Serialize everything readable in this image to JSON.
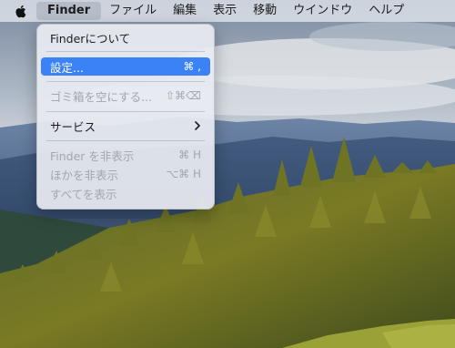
{
  "menubar": {
    "apple_icon": "apple-icon",
    "items": [
      "Finder",
      "ファイル",
      "編集",
      "表示",
      "移動",
      "ウインドウ",
      "ヘルプ"
    ]
  },
  "finder_menu": {
    "items": [
      {
        "label": "Finderについて",
        "shortcut": ""
      },
      {
        "label": "設定...",
        "shortcut": "⌘ ,",
        "state": "selected"
      },
      {
        "label": "ゴミ箱を空にする...",
        "shortcut": "⇧⌘⌫",
        "state": "disabled"
      },
      {
        "label": "サービス",
        "submenu_icon": "chevron-right-icon"
      },
      {
        "label": "Finder を非表示",
        "shortcut": "⌘ H",
        "state": "disabled"
      },
      {
        "label": "ほかを非表示",
        "shortcut": "⌥⌘ H",
        "state": "disabled"
      },
      {
        "label": "すべてを表示",
        "shortcut": "",
        "state": "disabled"
      }
    ]
  },
  "colors": {
    "selection": "#3b82f6",
    "disabled_text": "#a3a6ad"
  }
}
